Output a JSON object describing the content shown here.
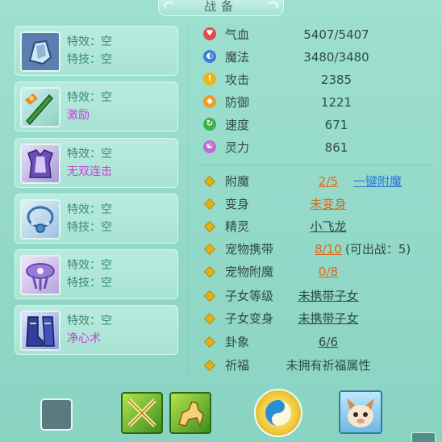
{
  "title": "战备",
  "equipment": [
    {
      "effect": "特效：空",
      "skill": "特技：空",
      "skill_highlight": false,
      "icon": "helmet-icon"
    },
    {
      "effect": "特效：空",
      "skill": "激励",
      "skill_highlight": true,
      "icon": "sword-icon"
    },
    {
      "effect": "特效：空",
      "skill": "无双连击",
      "skill_highlight": true,
      "icon": "armor-icon"
    },
    {
      "effect": "特效：空",
      "skill": "特技：空",
      "skill_highlight": false,
      "icon": "necklace-icon"
    },
    {
      "effect": "特效：空",
      "skill": "特技：空",
      "skill_highlight": false,
      "icon": "belt-icon"
    },
    {
      "effect": "特效：空",
      "skill": "净心术",
      "skill_highlight": true,
      "icon": "boots-icon"
    }
  ],
  "stats": [
    {
      "label": "气血",
      "value": "5407/5407",
      "icon": "heart-icon",
      "color": "#e24b4b"
    },
    {
      "label": "魔法",
      "value": "3480/3480",
      "icon": "mana-icon",
      "color": "#3a7fd6"
    },
    {
      "label": "攻击",
      "value": "2385",
      "icon": "attack-icon",
      "color": "#f0b21c"
    },
    {
      "label": "防御",
      "value": "1221",
      "icon": "defense-icon",
      "color": "#f09a2c"
    },
    {
      "label": "速度",
      "value": "671",
      "icon": "speed-icon",
      "color": "#3fb04a"
    },
    {
      "label": "灵力",
      "value": "861",
      "icon": "spirit-icon",
      "color": "#c06ad8"
    }
  ],
  "attributes": [
    {
      "label": "附魔",
      "value": "2/5",
      "style": "orange",
      "extra": "一键附魔",
      "extra_style": "link"
    },
    {
      "label": "变身",
      "value": "未变身",
      "style": "orange",
      "extra": "",
      "extra_style": ""
    },
    {
      "label": "精灵",
      "value": "小飞龙",
      "style": "dark",
      "extra": "",
      "extra_style": ""
    },
    {
      "label": "宠物携带",
      "value": "8/10",
      "style": "orange",
      "extra": "(可出战：5)",
      "extra_style": "gray"
    },
    {
      "label": "宠物附魔",
      "value": "0/8",
      "style": "orange",
      "extra": "",
      "extra_style": ""
    },
    {
      "label": "子女等级",
      "value": "未携带子女",
      "style": "dark",
      "extra": "",
      "extra_style": ""
    },
    {
      "label": "子女变身",
      "value": "未携带子女",
      "style": "dark",
      "extra": "",
      "extra_style": ""
    },
    {
      "label": "卦象",
      "value": "6/6",
      "style": "dark",
      "extra": "",
      "extra_style": ""
    },
    {
      "label": "祈福",
      "value": "未拥有祈福属性",
      "style": "plain",
      "extra": "",
      "extra_style": ""
    }
  ],
  "bottom_icons": [
    "empty-slot-icon",
    "crossed-swords-icon",
    "horse-icon",
    "yin-yang-icon",
    "pet-avatar-icon"
  ]
}
